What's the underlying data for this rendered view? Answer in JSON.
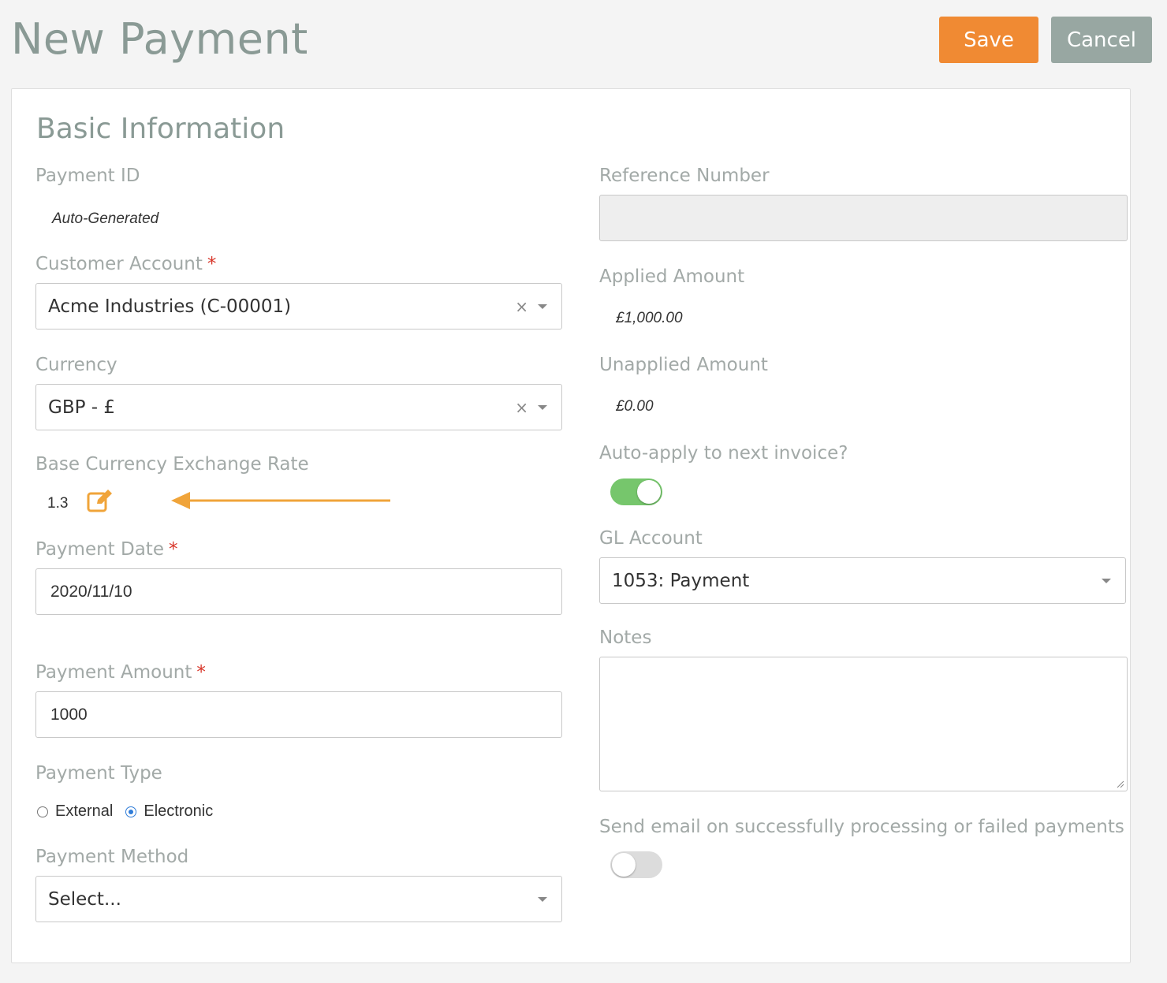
{
  "header": {
    "title": "New Payment",
    "save_label": "Save",
    "cancel_label": "Cancel"
  },
  "section": {
    "title": "Basic Information"
  },
  "left": {
    "payment_id": {
      "label": "Payment ID",
      "value": "Auto-Generated"
    },
    "customer_account": {
      "label": "Customer Account",
      "required": "*",
      "value": "Acme Industries (C-00001)",
      "clear": "×"
    },
    "currency": {
      "label": "Currency",
      "value": "GBP - £",
      "clear": "×"
    },
    "exchange_rate": {
      "label": "Base Currency Exchange Rate",
      "value": "1.3"
    },
    "payment_date": {
      "label": "Payment Date",
      "required": "*",
      "value": "2020/11/10"
    },
    "payment_amount": {
      "label": "Payment Amount",
      "required": "*",
      "value": "1000"
    },
    "payment_type": {
      "label": "Payment Type",
      "options": [
        "External",
        "Electronic"
      ],
      "selected": "Electronic"
    },
    "payment_method": {
      "label": "Payment Method",
      "value": "Select..."
    }
  },
  "right": {
    "reference_number": {
      "label": "Reference Number",
      "value": ""
    },
    "applied_amount": {
      "label": "Applied Amount",
      "value": "£1,000.00"
    },
    "unapplied_amount": {
      "label": "Unapplied Amount",
      "value": "£0.00"
    },
    "auto_apply": {
      "label": "Auto-apply to next invoice?",
      "state": "on"
    },
    "gl_account": {
      "label": "GL Account",
      "value": "1053: Payment"
    },
    "notes": {
      "label": "Notes",
      "value": ""
    },
    "send_email": {
      "label": "Send email on successfully processing or failed payments",
      "state": "off"
    }
  },
  "colors": {
    "save": "#f08a33",
    "cancel": "#98a7a2",
    "edit_icon": "#f0a43a",
    "annotation_arrow": "#f0a43a",
    "toggle_on": "#76c66c",
    "toggle_off": "#dcdcdc",
    "required": "#d8362a",
    "radio_selected": "#2f7cd8"
  },
  "icons": {
    "edit": "edit-icon",
    "dropdown": "chevron-down-icon",
    "clear": "clear-icon",
    "annotation": "arrow-left-icon"
  }
}
